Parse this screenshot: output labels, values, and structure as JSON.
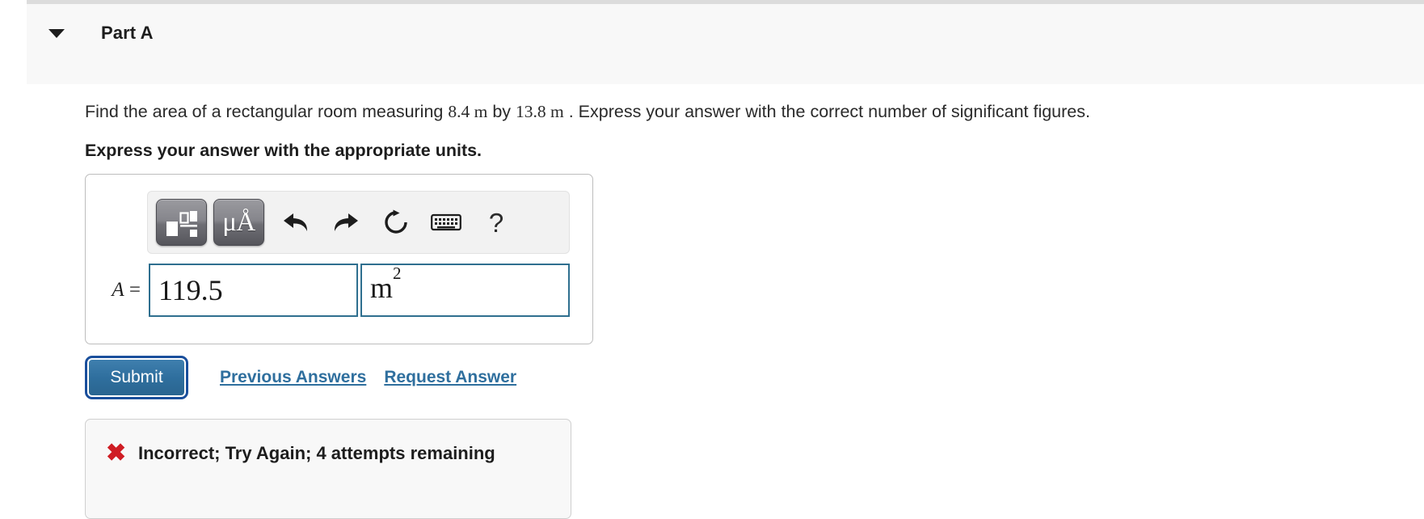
{
  "part": {
    "title": "Part A",
    "disclosure_icon": "triangle-down-icon",
    "expanded": true
  },
  "question": {
    "statement_prefix": "Find the area of a rectangular room measuring ",
    "dim1": "8.4 m",
    "statement_mid": " by ",
    "dim2": "13.8 m",
    "statement_suffix": " . Express your answer with the correct number of significant figures.",
    "instruction": "Express your answer with the appropriate units."
  },
  "toolbar": {
    "buttons": [
      {
        "name": "template-icon",
        "label": ""
      },
      {
        "name": "units-icon",
        "label": "μÅ"
      }
    ],
    "icons": [
      {
        "name": "undo-icon",
        "label": "undo"
      },
      {
        "name": "redo-icon",
        "label": "redo"
      },
      {
        "name": "reset-icon",
        "label": "reset"
      },
      {
        "name": "keyboard-icon",
        "label": "keyboard"
      },
      {
        "name": "help-icon",
        "label": "?"
      }
    ]
  },
  "answer": {
    "label": "A",
    "equals": "=",
    "value": "119.5",
    "value_placeholder": "",
    "unit_base": "m",
    "unit_exponent": "2",
    "unit_placeholder": "",
    "border_color": "#2f6f8f"
  },
  "actions": {
    "submit_label": "Submit",
    "previous_answers_label": "Previous Answers",
    "request_answer_label": "Request Answer",
    "link_color": "#2f6f9e",
    "submit_color": "#2f6f9e"
  },
  "feedback": {
    "icon": "x-mark-icon",
    "icon_glyph": "✖",
    "icon_color": "#cf1d24",
    "message": "Incorrect; Try Again; 4 attempts remaining"
  }
}
